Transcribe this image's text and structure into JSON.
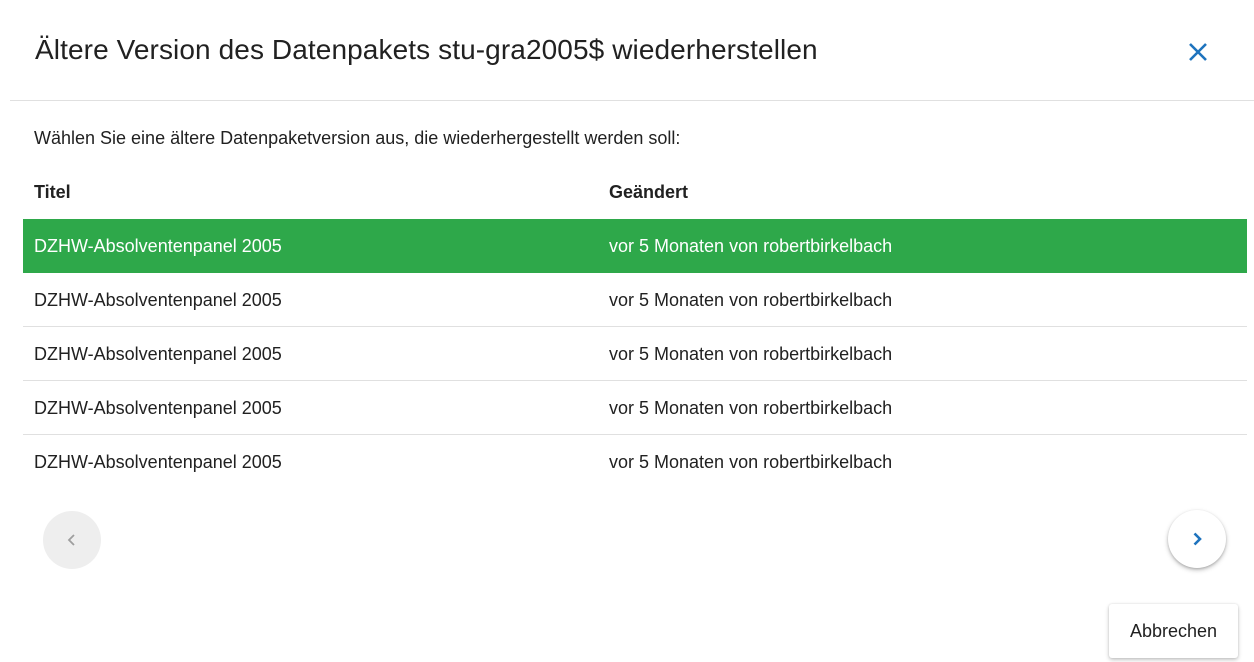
{
  "dialog": {
    "title": "Ältere Version des Datenpakets stu-gra2005$ wiederherstellen",
    "close_icon": "close-icon",
    "prompt": "Wählen Sie eine ältere Datenpaketversion aus, die wiederhergestellt werden soll:"
  },
  "table": {
    "headers": {
      "title": "Titel",
      "changed": "Geändert"
    },
    "rows": [
      {
        "title": "DZHW-Absolventenpanel 2005",
        "changed": "vor 5 Monaten von robertbirkelbach",
        "selected": true
      },
      {
        "title": "DZHW-Absolventenpanel 2005",
        "changed": "vor 5 Monaten von robertbirkelbach",
        "selected": false
      },
      {
        "title": "DZHW-Absolventenpanel 2005",
        "changed": "vor 5 Monaten von robertbirkelbach",
        "selected": false
      },
      {
        "title": "DZHW-Absolventenpanel 2005",
        "changed": "vor 5 Monaten von robertbirkelbach",
        "selected": false
      },
      {
        "title": "DZHW-Absolventenpanel 2005",
        "changed": "vor 5 Monaten von robertbirkelbach",
        "selected": false
      }
    ]
  },
  "pagination": {
    "prev_icon": "chevron-left-icon",
    "next_icon": "chevron-right-icon",
    "prev_enabled": false,
    "next_enabled": true
  },
  "actions": {
    "cancel_label": "Abbrechen"
  },
  "colors": {
    "accent": "#1e73be",
    "selected_row": "#2ea84a",
    "disabled_icon": "#9e9e9e"
  }
}
